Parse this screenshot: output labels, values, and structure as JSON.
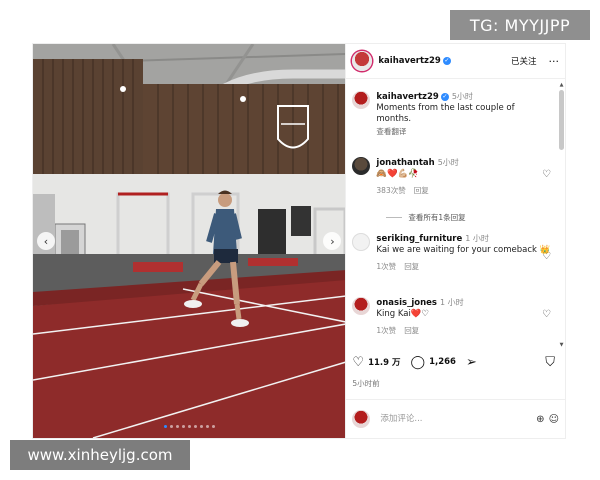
{
  "watermarks": {
    "top": "TG: MYYJJPP",
    "bottom": "www.xinheyljg.com"
  },
  "colors": {
    "accent": "#2e8bff",
    "track": "#8e2b2a",
    "heart_red": "#d0021b"
  },
  "media": {
    "icons": {
      "prev": "chevron-left-icon",
      "next": "chevron-right-icon"
    },
    "carousel_dots": 9,
    "active_dot": 0
  },
  "header": {
    "username": "kaihavertz29",
    "follow_label": "已关注",
    "more": "···"
  },
  "comments": [
    {
      "user": "kaihavertz29",
      "time": "5小时",
      "text": "Moments from the last couple of months.",
      "translate": "查看翻译"
    },
    {
      "user": "jonathantah",
      "time": "5小时",
      "text": "🙈❤️💪🏼🥀",
      "likes": "383次赞",
      "reply": "回复",
      "view_replies": "查看所有1条回复"
    },
    {
      "user": "seriking_furniture",
      "time": "1 小时",
      "text": "Kai we are waiting for your comeback 👑",
      "likes": "1次赞",
      "reply": "回复"
    },
    {
      "user": "onasis_jones",
      "time": "1 小时",
      "text": "King Kai❤️♡",
      "likes": "1次赞",
      "reply": "回复"
    }
  ],
  "actions": {
    "like_count": "11.9 万",
    "comment_count": "1,266"
  },
  "post_time": "5小时前",
  "comment_input": {
    "placeholder": "添加评论..."
  }
}
